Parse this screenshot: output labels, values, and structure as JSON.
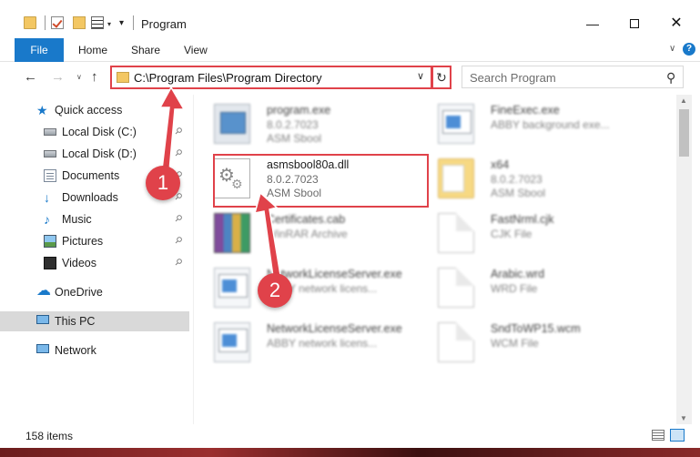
{
  "window": {
    "title": "Program",
    "min_glyph": "—",
    "close_glyph": "✕"
  },
  "quick_access_toolbar": {
    "down_arrow": "▾"
  },
  "ribbon": {
    "tabs": [
      {
        "label": "File",
        "active": true
      },
      {
        "label": "Home"
      },
      {
        "label": "Share"
      },
      {
        "label": "View"
      }
    ],
    "expand_glyph": "∨",
    "help_glyph": "?"
  },
  "address_bar": {
    "back_glyph": "←",
    "forward_glyph": "→",
    "recent_glyph": "∨",
    "up_glyph": "↑",
    "path": "C:\\Program Files\\Program Directory",
    "chevron": "∨",
    "refresh_glyph": "↻"
  },
  "search": {
    "placeholder": "Search Program",
    "icon_glyph": "⚲"
  },
  "sidebar": {
    "items": [
      {
        "label": "Quick access",
        "icon": "star-icon"
      },
      {
        "label": "Local Disk (C:)",
        "icon": "disk-icon",
        "pinned": true
      },
      {
        "label": "Local Disk (D:)",
        "icon": "disk-icon",
        "pinned": true
      },
      {
        "label": "Documents",
        "icon": "documents-icon",
        "pinned": true
      },
      {
        "label": "Downloads",
        "icon": "downloads-icon",
        "pinned": true
      },
      {
        "label": "Music",
        "icon": "music-icon",
        "pinned": true
      },
      {
        "label": "Pictures",
        "icon": "pictures-icon",
        "pinned": true
      },
      {
        "label": "Videos",
        "icon": "videos-icon",
        "pinned": true
      },
      {
        "label": "OneDrive",
        "icon": "onedrive-icon"
      },
      {
        "label": "This PC",
        "icon": "pc-icon",
        "selected": true
      },
      {
        "label": "Network",
        "icon": "network-icon"
      }
    ],
    "pin_glyph": "📌",
    "star_glyph": "★",
    "download_glyph": "↓",
    "music_glyph": "♪",
    "cloud_glyph": "☁"
  },
  "files": [
    {
      "name": "program.exe",
      "line2": "8.0.2.7023",
      "line3": "ASM Sbool",
      "icon": "exe-icon"
    },
    {
      "name": "FineExec.exe",
      "line2": "ABBY background exe...",
      "line3": "",
      "icon": "window-app-icon"
    },
    {
      "name": "asmsbool80a.dll",
      "line2": "8.0.2.7023",
      "line3": "ASM Sbool",
      "icon": "dll-icon"
    },
    {
      "name": "x64",
      "line2": "8.0.2.7023",
      "line3": "ASM Sbool",
      "icon": "folder-icon"
    },
    {
      "name": "Certificates.cab",
      "line2": "WinRAR Archive",
      "line3": "",
      "icon": "winrar-icon"
    },
    {
      "name": "FastNrml.cjk",
      "line2": "CJK File",
      "line3": "",
      "icon": "file-icon"
    },
    {
      "name": "NetworkLicenseServer.exe",
      "line2": "ABBY network licens...",
      "line3": "",
      "icon": "window-app-icon"
    },
    {
      "name": "Arabic.wrd",
      "line2": "WRD File",
      "line3": "",
      "icon": "file-icon"
    },
    {
      "name": "NetworkLicenseServer.exe",
      "line2": "ABBY network licens...",
      "line3": "",
      "icon": "window-app-icon"
    },
    {
      "name": "SndToWP15.wcm",
      "line2": "WCM File",
      "line3": "",
      "icon": "file-icon"
    }
  ],
  "scrollbar": {
    "up_glyph": "▲",
    "down_glyph": "▼"
  },
  "status_bar": {
    "item_count": "158 items"
  },
  "annotations": {
    "callout_1": "1",
    "callout_2": "2",
    "highlight_color": "#e0424a"
  }
}
